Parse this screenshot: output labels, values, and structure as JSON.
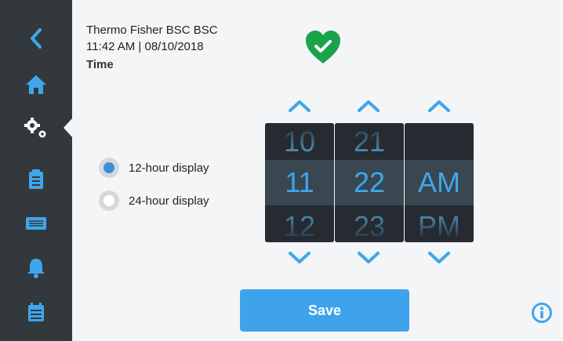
{
  "header": {
    "device_name": "Thermo Fisher BSC BSC",
    "datetime": "11:42  AM | 08/10/2018",
    "section_title": "Time"
  },
  "sidebar": {
    "items": [
      {
        "icon": "back-chevron-icon"
      },
      {
        "icon": "home-icon"
      },
      {
        "icon": "settings-gears-icon",
        "active": true
      },
      {
        "icon": "clipboard-icon"
      },
      {
        "icon": "panel-icon"
      },
      {
        "icon": "bell-icon"
      },
      {
        "icon": "calendar-icon"
      }
    ]
  },
  "status": {
    "icon": "heart-check-icon",
    "color": "#1aa34a"
  },
  "time_format": {
    "options": [
      {
        "label": "12-hour display",
        "selected": true
      },
      {
        "label": "24-hour display",
        "selected": false
      }
    ]
  },
  "picker": {
    "hour": {
      "prev": "10",
      "current": "11",
      "next": "12"
    },
    "minute": {
      "prev": "21",
      "current": "22",
      "next": "23"
    },
    "period": {
      "prev": "",
      "current": "AM",
      "next": "PM"
    }
  },
  "actions": {
    "save_label": "Save"
  },
  "colors": {
    "accent": "#3fa3ec",
    "sidebar": "#33383d",
    "nav_icon": "#3ea6ec",
    "success": "#1aa34a"
  }
}
